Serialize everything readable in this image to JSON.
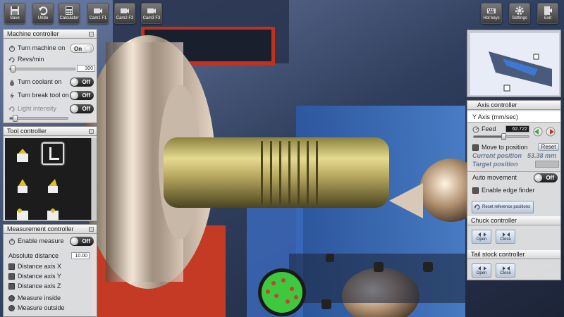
{
  "toolbar": {
    "save": "Save",
    "undo": "Undo",
    "calculator": "Calculator",
    "cam1": "Cam1 F1",
    "cam2": "Cam2 F2",
    "cam3": "Cam3 F3",
    "hotkeys": "Hot keys",
    "settings": "Settings",
    "exit": "Exit"
  },
  "machine": {
    "title": "Machine controller",
    "turn_on": "Turn machine on",
    "turn_on_state": "On",
    "revs": "Revs/min",
    "revs_value": "300",
    "revs_level": 0.05,
    "coolant": "Turn coolant on",
    "coolant_state": "Off",
    "break_tool": "Turn break tool on",
    "break_tool_state": "Off",
    "light": "Light intensity",
    "light_state": "Off",
    "light_level": 0.1
  },
  "tool": {
    "title": "Tool controller",
    "selected_index": 1
  },
  "measure": {
    "title": "Measurement controller",
    "enable": "Enable measure",
    "enable_state": "Off",
    "abs_dist": "Absolute distance",
    "abs_value": "10.00",
    "axis_x": "Distance axis X",
    "axis_y": "Distance axis Y",
    "axis_z": "Distance axis Z",
    "inside": "Measure inside",
    "outside": "Measure outside"
  },
  "axis": {
    "title": "Axis controller",
    "mode": "Y Axis (mm/sec)",
    "feed": "Feed",
    "feed_value": "62.722",
    "feed_level": 0.55,
    "move": "Move to position",
    "reset": "Reset",
    "current": "Current position",
    "current_value": "53.38 mm",
    "target": "Target position",
    "auto": "Auto movement",
    "auto_state": "Off",
    "edge": "Enable edge finder",
    "reset_ref": "Reset reference positions"
  },
  "chuck": {
    "title": "Chuck controller",
    "open1": "Open",
    "open2": "Close"
  },
  "tail": {
    "title": "Tail stock controller",
    "open1": "Open",
    "open2": "Close"
  },
  "colors": {
    "panel": "#e8e8e8",
    "scene_bg": "#3a4a66",
    "brass": "#b8a860",
    "toggle_dark": "#1a1a1a"
  }
}
